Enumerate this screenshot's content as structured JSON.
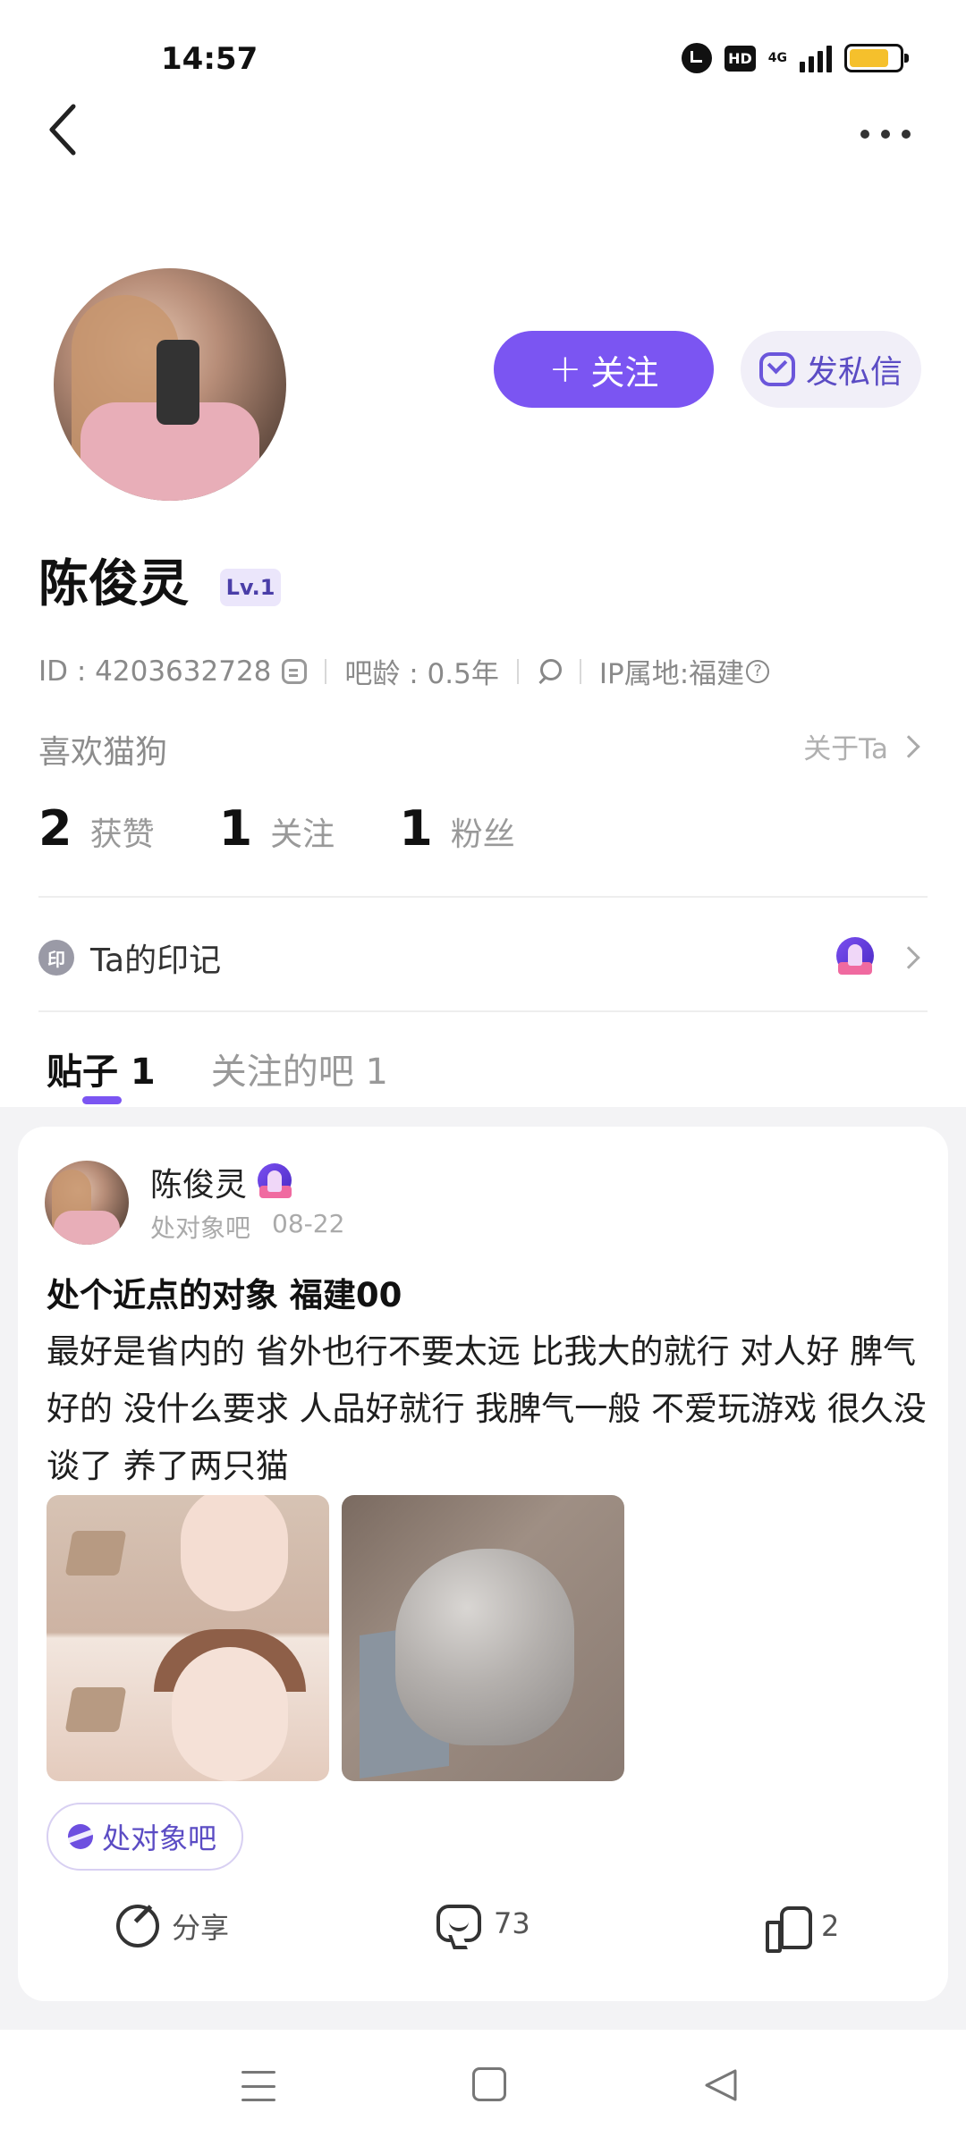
{
  "status_bar": {
    "time": "14:57",
    "hd_label": "HD",
    "network_label": "4G",
    "icons": [
      "alarm-icon",
      "hd-icon",
      "signal-icon",
      "battery-icon"
    ]
  },
  "nav": {
    "back_icon": "back-chevron-icon",
    "more_icon": "more-dots-icon"
  },
  "profile": {
    "name": "陈俊灵",
    "level": "Lv.1",
    "follow_label": "关注",
    "follow_plus": "+",
    "message_label": "发私信",
    "id_text": "ID : 4203632728",
    "bar_age": "吧龄 : 0.5年",
    "ip_location": "IP属地:福建",
    "bio": "喜欢猫狗",
    "about_label": "关于Ta"
  },
  "stats": [
    {
      "value": "2",
      "label": "获赞"
    },
    {
      "value": "1",
      "label": "关注"
    },
    {
      "value": "1",
      "label": "粉丝"
    }
  ],
  "imprint": {
    "icon_text": "印",
    "label": "Ta的印记"
  },
  "tabs": [
    {
      "label": "贴子 1",
      "active": true
    },
    {
      "label": "关注的吧 1",
      "active": false
    }
  ],
  "post": {
    "author": "陈俊灵",
    "forum": "处对象吧",
    "date": "08-22",
    "title": "处个近点的对象 福建00",
    "body": "最好是省内的 省外也行不要太远 比我大的就行 对人好 脾气好的 没什么要求 人品好就行 我脾气一般 不爱玩游戏 很久没谈了 养了两只猫",
    "tag": "处对象吧",
    "share_label": "分享",
    "comment_count": "73",
    "like_count": "2"
  },
  "colors": {
    "accent": "#7b55f2",
    "accent_light": "#f1eff8",
    "feed_bg": "#f3f3f5",
    "battery": "#f5c02c"
  }
}
